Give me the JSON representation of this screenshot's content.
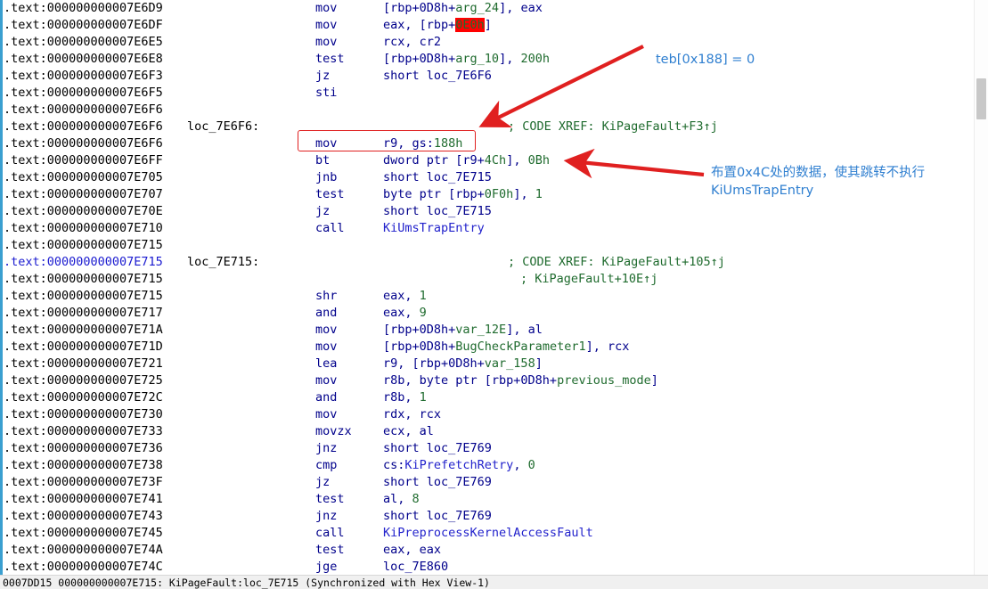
{
  "window": {
    "tool": "IDA Pro",
    "view": "IDA View-A"
  },
  "segment_prefix": ".text:",
  "listing": [
    {
      "addr": ".text:000000000007E6D9",
      "label": "",
      "mnem": "mov",
      "ops_html": "[rbp+0D8h+<span class=\"var\">arg_24</span>], eax",
      "ops_text": "[rbp+0D8h+arg_24], eax",
      "xref": "",
      "cursor": false
    },
    {
      "addr": ".text:000000000007E6DF",
      "label": "",
      "mnem": "mov",
      "ops_html": "eax, [rbp+<span class=\"hl\">0E0h</span>]",
      "ops_text": "eax, [rbp+0E0h]",
      "xref": "",
      "cursor": false
    },
    {
      "addr": ".text:000000000007E6E5",
      "label": "",
      "mnem": "mov",
      "ops_html": "rcx, cr2",
      "ops_text": "rcx, cr2",
      "xref": "",
      "cursor": false
    },
    {
      "addr": ".text:000000000007E6E8",
      "label": "",
      "mnem": "test",
      "ops_html": "[rbp+0D8h+<span class=\"var\">arg_10</span>], <span class=\"num\">200h</span>",
      "ops_text": "[rbp+0D8h+arg_10], 200h",
      "xref": "",
      "cursor": false
    },
    {
      "addr": ".text:000000000007E6F3",
      "label": "",
      "mnem": "jz",
      "ops_html": "short <span class=\"loc\">loc_7E6F6</span>",
      "ops_text": "short loc_7E6F6",
      "xref": "",
      "cursor": false
    },
    {
      "addr": ".text:000000000007E6F5",
      "label": "",
      "mnem": "sti",
      "ops_html": "",
      "ops_text": "",
      "xref": "",
      "cursor": false
    },
    {
      "addr": ".text:000000000007E6F6",
      "label": "",
      "mnem": "",
      "ops_html": "",
      "ops_text": "",
      "xref": "",
      "cursor": false
    },
    {
      "addr": ".text:000000000007E6F6",
      "label": "loc_7E6F6:",
      "mnem": "",
      "ops_html": "",
      "ops_text": "",
      "xref": "; CODE XREF: KiPageFault+F3↑j",
      "cursor": false
    },
    {
      "addr": ".text:000000000007E6F6",
      "label": "",
      "mnem": "mov",
      "ops_html": "r9, gs:<span class=\"num\">188h</span>",
      "ops_text": "r9, gs:188h",
      "xref": "",
      "cursor": false
    },
    {
      "addr": ".text:000000000007E6FF",
      "label": "",
      "mnem": "bt",
      "ops_html": "dword ptr [r9+<span class=\"num\">4Ch</span>], <span class=\"num\">0Bh</span>",
      "ops_text": "dword ptr [r9+4Ch], 0Bh",
      "xref": "",
      "cursor": false
    },
    {
      "addr": ".text:000000000007E705",
      "label": "",
      "mnem": "jnb",
      "ops_html": "short <span class=\"loc\">loc_7E715</span>",
      "ops_text": "short loc_7E715",
      "xref": "",
      "cursor": false
    },
    {
      "addr": ".text:000000000007E707",
      "label": "",
      "mnem": "test",
      "ops_html": "byte ptr [rbp+<span class=\"num\">0F0h</span>], <span class=\"num\">1</span>",
      "ops_text": "byte ptr [rbp+0F0h], 1",
      "xref": "",
      "cursor": false
    },
    {
      "addr": ".text:000000000007E70E",
      "label": "",
      "mnem": "jz",
      "ops_html": "short <span class=\"loc\">loc_7E715</span>",
      "ops_text": "short loc_7E715",
      "xref": "",
      "cursor": false
    },
    {
      "addr": ".text:000000000007E710",
      "label": "",
      "mnem": "call",
      "ops_html": "<span class=\"fn\">KiUmsTrapEntry</span>",
      "ops_text": "KiUmsTrapEntry",
      "xref": "",
      "cursor": false
    },
    {
      "addr": ".text:000000000007E715",
      "label": "",
      "mnem": "",
      "ops_html": "",
      "ops_text": "",
      "xref": "",
      "cursor": false
    },
    {
      "addr": ".text:000000000007E715",
      "label": "loc_7E715:",
      "mnem": "",
      "ops_html": "",
      "ops_text": "",
      "xref": "; CODE XREF: KiPageFault+105↑j",
      "cursor": true
    },
    {
      "addr": ".text:000000000007E715",
      "label": "",
      "mnem": "",
      "ops_html": "",
      "ops_text": "",
      "xref": "; KiPageFault+10E↑j",
      "xref_cont": true,
      "cursor": false
    },
    {
      "addr": ".text:000000000007E715",
      "label": "",
      "mnem": "shr",
      "ops_html": "eax, <span class=\"num\">1</span>",
      "ops_text": "eax, 1",
      "xref": "",
      "cursor": false
    },
    {
      "addr": ".text:000000000007E717",
      "label": "",
      "mnem": "and",
      "ops_html": "eax, <span class=\"num\">9</span>",
      "ops_text": "eax, 9",
      "xref": "",
      "cursor": false
    },
    {
      "addr": ".text:000000000007E71A",
      "label": "",
      "mnem": "mov",
      "ops_html": "[rbp+0D8h+<span class=\"var\">var_12E</span>], al",
      "ops_text": "[rbp+0D8h+var_12E], al",
      "xref": "",
      "cursor": false
    },
    {
      "addr": ".text:000000000007E71D",
      "label": "",
      "mnem": "mov",
      "ops_html": "[rbp+0D8h+<span class=\"var\">BugCheckParameter1</span>], rcx",
      "ops_text": "[rbp+0D8h+BugCheckParameter1], rcx",
      "xref": "",
      "cursor": false
    },
    {
      "addr": ".text:000000000007E721",
      "label": "",
      "mnem": "lea",
      "ops_html": "r9, [rbp+0D8h+<span class=\"var\">var_158</span>]",
      "ops_text": "r9, [rbp+0D8h+var_158]",
      "xref": "",
      "cursor": false
    },
    {
      "addr": ".text:000000000007E725",
      "label": "",
      "mnem": "mov",
      "ops_html": "r8b, byte ptr [rbp+0D8h+<span class=\"var\">previous_mode</span>]",
      "ops_text": "r8b, byte ptr [rbp+0D8h+previous_mode]",
      "xref": "",
      "cursor": false
    },
    {
      "addr": ".text:000000000007E72C",
      "label": "",
      "mnem": "and",
      "ops_html": "r8b, <span class=\"num\">1</span>",
      "ops_text": "r8b, 1",
      "xref": "",
      "cursor": false
    },
    {
      "addr": ".text:000000000007E730",
      "label": "",
      "mnem": "mov",
      "ops_html": "rdx, rcx",
      "ops_text": "rdx, rcx",
      "xref": "",
      "cursor": false
    },
    {
      "addr": ".text:000000000007E733",
      "label": "",
      "mnem": "movzx",
      "ops_html": "ecx, al",
      "ops_text": "ecx, al",
      "xref": "",
      "cursor": false
    },
    {
      "addr": ".text:000000000007E736",
      "label": "",
      "mnem": "jnz",
      "ops_html": "short <span class=\"loc\">loc_7E769</span>",
      "ops_text": "short loc_7E769",
      "xref": "",
      "cursor": false
    },
    {
      "addr": ".text:000000000007E738",
      "label": "",
      "mnem": "cmp",
      "ops_html": "cs:<span class=\"fn\">KiPrefetchRetry</span>, <span class=\"num\">0</span>",
      "ops_text": "cs:KiPrefetchRetry, 0",
      "xref": "",
      "cursor": false
    },
    {
      "addr": ".text:000000000007E73F",
      "label": "",
      "mnem": "jz",
      "ops_html": "short <span class=\"loc\">loc_7E769</span>",
      "ops_text": "short loc_7E769",
      "xref": "",
      "cursor": false
    },
    {
      "addr": ".text:000000000007E741",
      "label": "",
      "mnem": "test",
      "ops_html": "al, <span class=\"num\">8</span>",
      "ops_text": "al, 8",
      "xref": "",
      "cursor": false
    },
    {
      "addr": ".text:000000000007E743",
      "label": "",
      "mnem": "jnz",
      "ops_html": "short <span class=\"loc\">loc_7E769</span>",
      "ops_text": "short loc_7E769",
      "xref": "",
      "cursor": false
    },
    {
      "addr": ".text:000000000007E745",
      "label": "",
      "mnem": "call",
      "ops_html": "<span class=\"fn\">KiPreprocessKernelAccessFault</span>",
      "ops_text": "KiPreprocessKernelAccessFault",
      "xref": "",
      "cursor": false
    },
    {
      "addr": ".text:000000000007E74A",
      "label": "",
      "mnem": "test",
      "ops_html": "eax, eax",
      "ops_text": "eax, eax",
      "xref": "",
      "cursor": false
    },
    {
      "addr": ".text:000000000007E74C",
      "label": "",
      "mnem": "jge",
      "ops_html": "<span class=\"loc\">loc_7E860</span>",
      "ops_text": "loc_7E860",
      "xref": "",
      "cursor": false
    }
  ],
  "annotations": [
    {
      "id": "annot-1",
      "text": "teb[0x188] = 0"
    },
    {
      "id": "annot-2",
      "text": "布置0x4C处的数据，使其跳转不执行\nKiUmsTrapEntry"
    }
  ],
  "statusbar": {
    "text": "0007DD15 000000000007E715: KiPageFault:loc_7E715 (Synchronized with Hex View-1)"
  },
  "colors": {
    "highlight_bg": "#ff0000",
    "annotation": "#2f7fd0",
    "arrow": "#e02020",
    "cursor_addr": "#1a1ad0",
    "mnemonic": "#00008b",
    "comment": "#1f6b2e",
    "function": "#2222cc",
    "nav_strip": "#3a9fd0"
  }
}
